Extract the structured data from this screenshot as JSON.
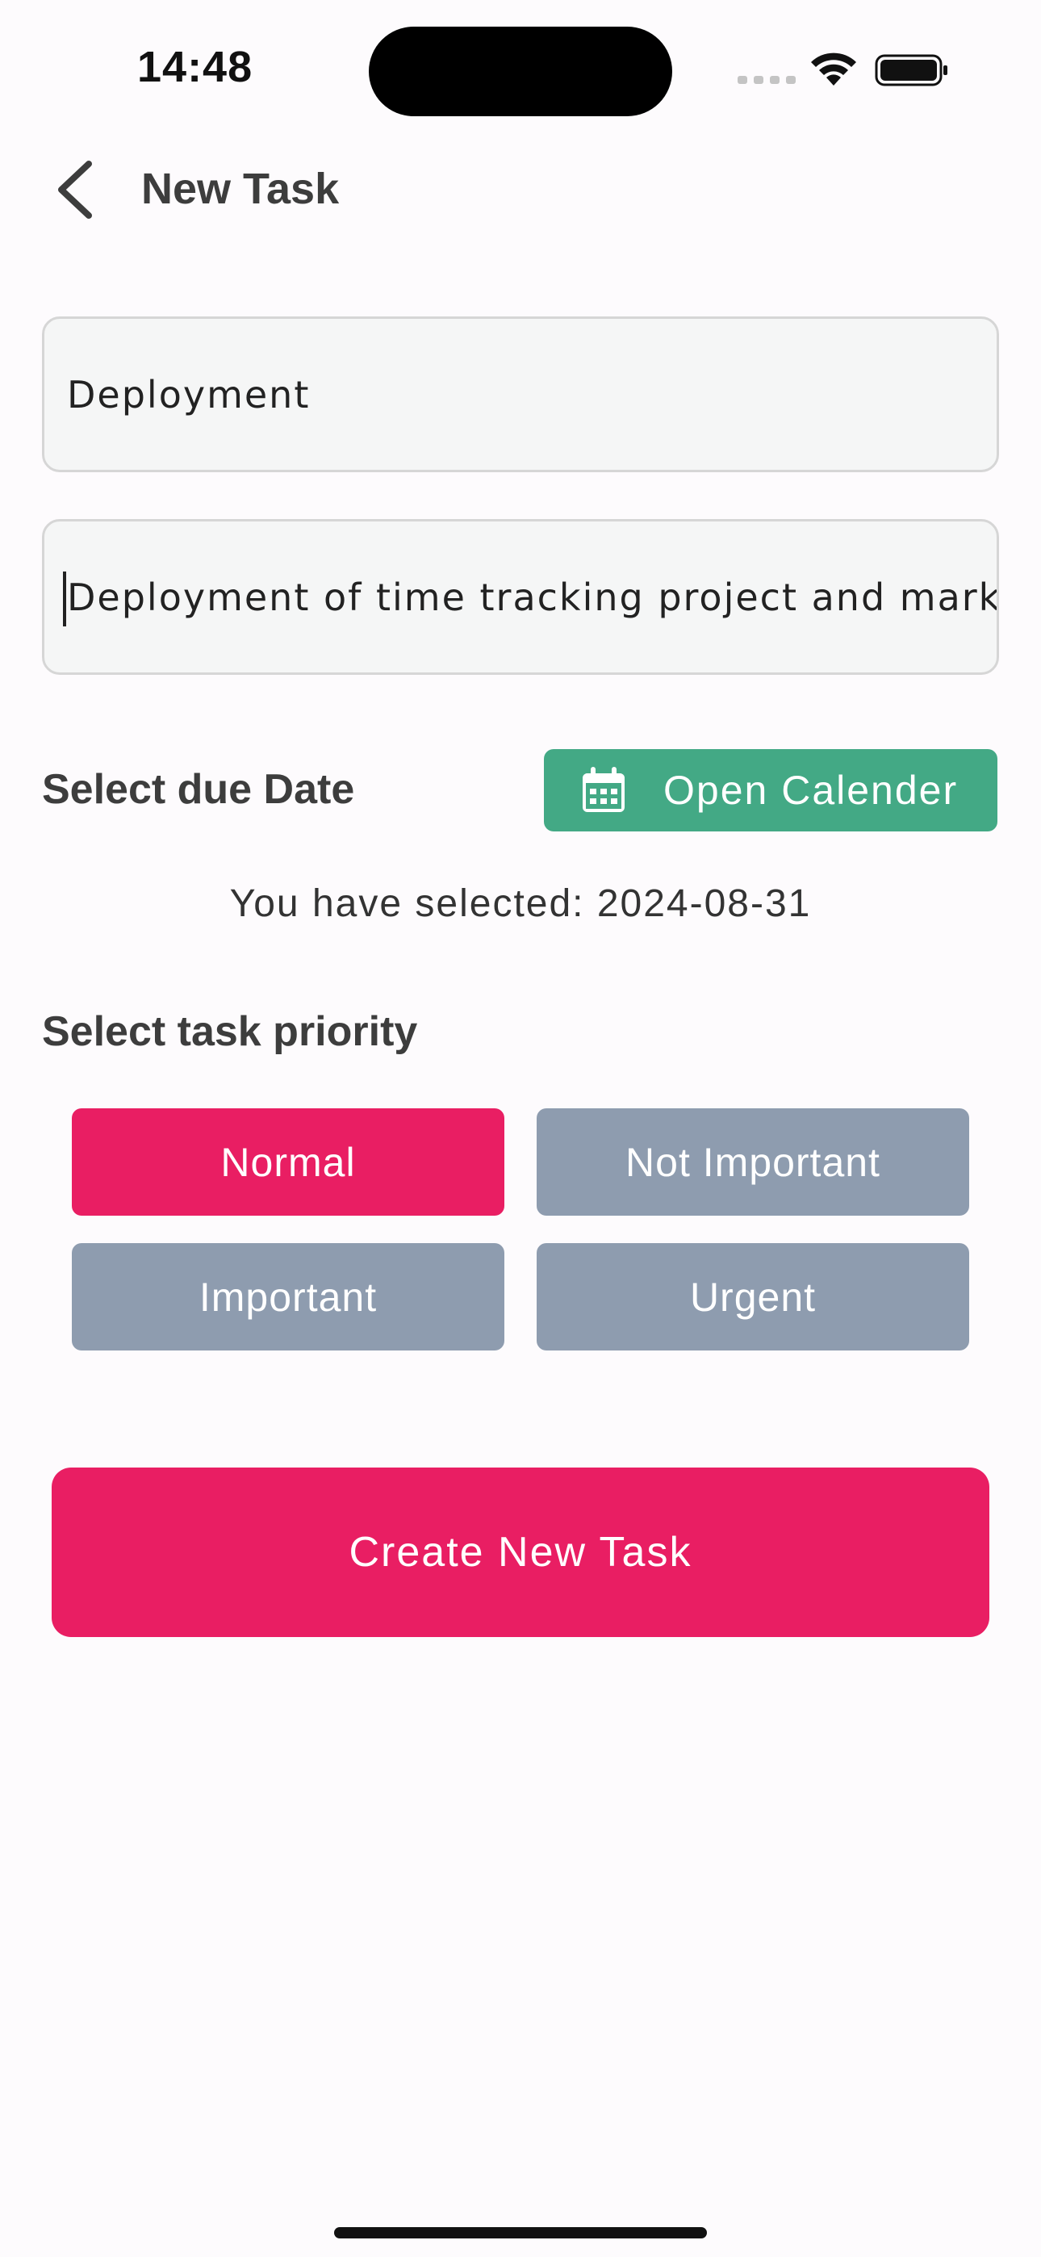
{
  "status_bar": {
    "time": "14:48"
  },
  "header": {
    "title": "New Task",
    "back_icon": "chevron-left-icon"
  },
  "form": {
    "title_value": "Deployment",
    "description_value": "Deployment of time tracking project and marketing"
  },
  "due_date": {
    "label": "Select due Date",
    "button_label": "Open Calender",
    "button_icon": "calendar-icon",
    "button_color": "#43a985",
    "selected_text": "You have selected: 2024-08-31"
  },
  "priority": {
    "label": "Select task priority",
    "options": [
      "Normal",
      "Not Important",
      "Important",
      "Urgent"
    ],
    "selected": "Normal",
    "active_color": "#e91e63",
    "inactive_color": "#8e9caf"
  },
  "submit": {
    "label": "Create New Task",
    "color": "#e91e63"
  }
}
